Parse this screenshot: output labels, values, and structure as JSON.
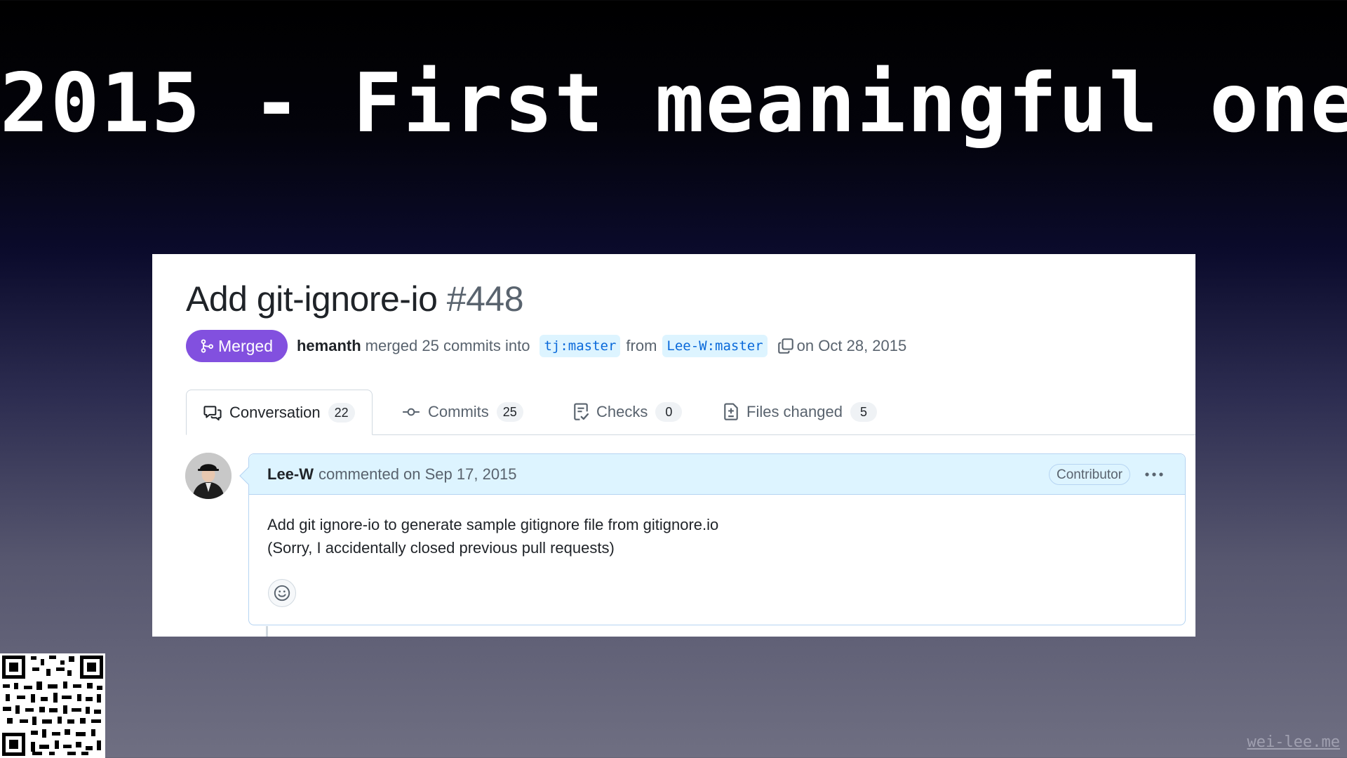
{
  "slide": {
    "title": "2015 - First meaningful one",
    "watermark": "wei-lee.me"
  },
  "pull_request": {
    "title": "Add git-ignore-io",
    "number": "#448",
    "state_label": "Merged",
    "merged_by": "hemanth",
    "merge_text": "merged 25 commits into",
    "base_branch": "tj:master",
    "from_text": "from",
    "head_branch": "Lee-W:master",
    "date_text": "on Oct 28, 2015"
  },
  "tabs": [
    {
      "label": "Conversation",
      "count": "22",
      "icon": "comment-discussion-icon",
      "active": true
    },
    {
      "label": "Commits",
      "count": "25",
      "icon": "git-commit-icon",
      "active": false
    },
    {
      "label": "Checks",
      "count": "0",
      "icon": "checklist-icon",
      "active": false
    },
    {
      "label": "Files changed",
      "count": "5",
      "icon": "file-diff-icon",
      "active": false
    }
  ],
  "comment": {
    "author": "Lee-W",
    "action_text": "commented on Sep 17, 2015",
    "badge": "Contributor",
    "body_lines": [
      "Add git ignore-io to generate sample gitignore file from gitignore.io",
      "(Sorry, I accidentally closed previous pull requests)"
    ]
  },
  "colors": {
    "merged": "#8250df",
    "link": "#0969da",
    "branch_bg": "#ddf4ff",
    "comment_header_bg": "#ddf4ff",
    "comment_border": "#b6d4f2"
  }
}
